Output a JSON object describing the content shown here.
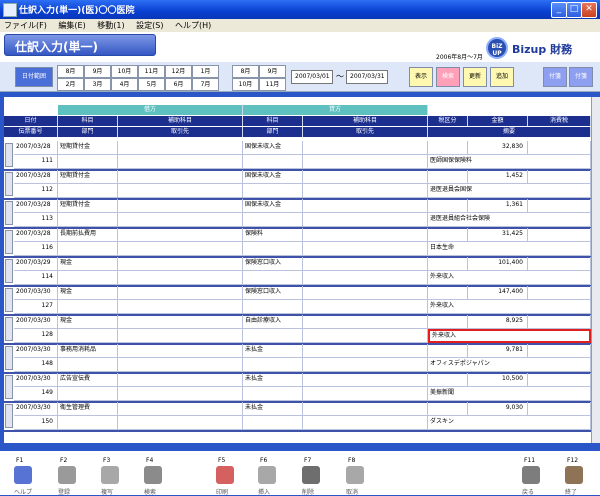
{
  "window": {
    "title": "仕訳入力(単一)(医)〇〇医院"
  },
  "menu": [
    "ファイル(F)",
    "編集(E)",
    "移動(1)",
    "設定(S)",
    "ヘルプ(H)"
  ],
  "header": {
    "screen_title": "仕訳入力(単一)",
    "period": "2006年8月〜7月",
    "logo_badge": "BiZ UP",
    "logo_text": "Bizup 財務"
  },
  "toolbar": {
    "date_range_label": "日付範囲",
    "months_top": [
      "8月",
      "9月",
      "10月",
      "11月",
      "12月",
      "1月"
    ],
    "months_bottom": [
      "2月",
      "3月",
      "4月",
      "5月",
      "6月",
      "7月"
    ],
    "months2_top": [
      "8月",
      "9月"
    ],
    "months2_bottom": [
      "10月",
      "11月"
    ],
    "date_from": "2007/03/01",
    "tilde": "〜",
    "date_to": "2007/03/31",
    "display": "表示",
    "search": "検索",
    "update": "更新",
    "add": "追加",
    "right1": "付箋",
    "right2": "付箋"
  },
  "columns": {
    "debit": "借方",
    "credit": "貸方",
    "date": "日付",
    "slip_no": "伝票番号",
    "d_account": "科目",
    "d_sub": "補助科目",
    "d_dept": "部門",
    "d_partner": "取引先",
    "c_account": "科目",
    "c_sub": "補助科目",
    "c_dept": "部門",
    "c_partner": "取引先",
    "tax": "税区分",
    "amount": "金額",
    "desc": "摘要",
    "consumption_tax": "消費税"
  },
  "rows": [
    {
      "date": "2007/03/28",
      "no": "111",
      "debit": "短期貸付金",
      "credit": "国保未収入金",
      "amount": "32,830",
      "desc": "医師国保保険料"
    },
    {
      "date": "2007/03/28",
      "no": "112",
      "debit": "短期貸付金",
      "credit": "国保未収入金",
      "amount": "1,452",
      "desc": "退医退員会国保"
    },
    {
      "date": "2007/03/28",
      "no": "113",
      "debit": "短期貸付金",
      "credit": "国保未収入金",
      "amount": "1,361",
      "desc": "退医退員組合社会保険"
    },
    {
      "date": "2007/03/28",
      "no": "116",
      "debit": "長期前払費用",
      "credit": "保険料",
      "amount": "31,425",
      "desc": "日本生命"
    },
    {
      "date": "2007/03/29",
      "no": "114",
      "debit": "現金",
      "credit": "保険窓口収入",
      "amount": "101,400",
      "desc": "外来収入"
    },
    {
      "date": "2007/03/30",
      "no": "127",
      "debit": "現金",
      "credit": "保険窓口収入",
      "amount": "147,400",
      "desc": "外来収入"
    },
    {
      "date": "2007/03/30",
      "no": "128",
      "debit": "現金",
      "credit": "自由診療収入",
      "amount": "8,925",
      "desc": "外来収入"
    },
    {
      "date": "2007/03/30",
      "no": "148",
      "debit": "事務用消耗品",
      "credit": "未払金",
      "amount": "9,781",
      "desc": "オフィスデポジャパン"
    },
    {
      "date": "2007/03/30",
      "no": "149",
      "debit": "広告宣伝費",
      "credit": "未払金",
      "amount": "10,500",
      "desc": "美振新聞"
    },
    {
      "date": "2007/03/30",
      "no": "150",
      "debit": "衛生管理費",
      "credit": "未払金",
      "amount": "9,030",
      "desc": "ダスキン"
    }
  ],
  "fkeys": [
    {
      "key": "F1",
      "label": "ヘルプ"
    },
    {
      "key": "F2",
      "label": "登録"
    },
    {
      "key": "F3",
      "label": "複写"
    },
    {
      "key": "F4",
      "label": "検索"
    },
    {
      "key": "F5",
      "label": "印刷"
    },
    {
      "key": "F6",
      "label": "挿入"
    },
    {
      "key": "F7",
      "label": "削除"
    },
    {
      "key": "F8",
      "label": "取消"
    },
    {
      "key": "F11",
      "label": "戻る"
    },
    {
      "key": "F12",
      "label": "終了"
    }
  ],
  "colors": {
    "accent": "#2b56c8",
    "highlight": "#e02020",
    "teal": "#5fc0c0",
    "navy": "#1c2f8f"
  }
}
